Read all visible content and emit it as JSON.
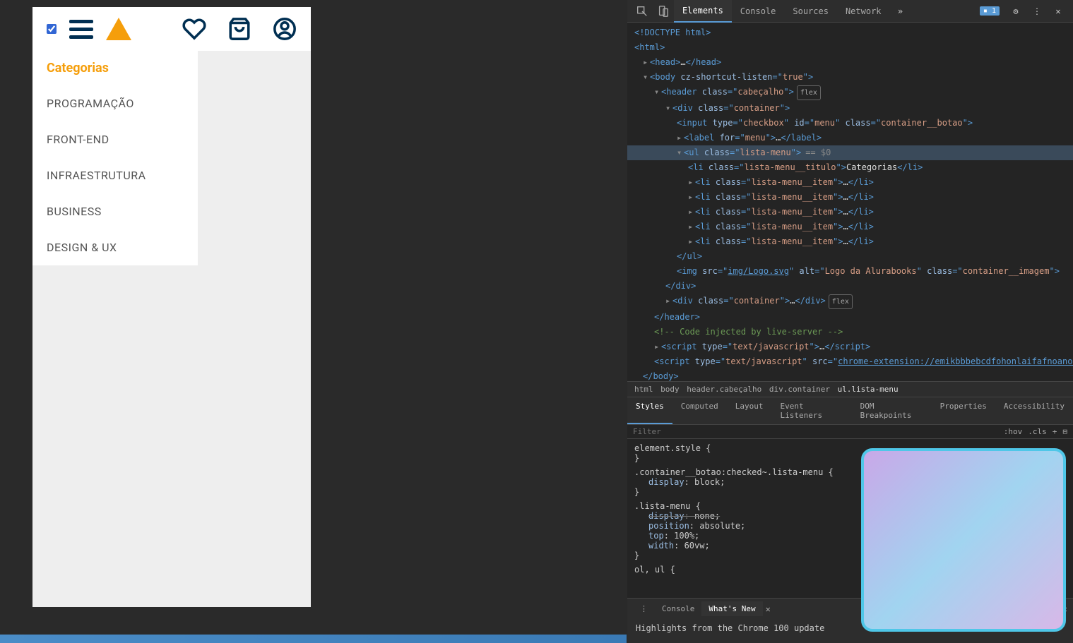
{
  "mobile": {
    "menu_title": "Categorias",
    "menu_items": [
      "PROGRAMAÇÃO",
      "FRONT-END",
      "INFRAESTRUTURA",
      "BUSINESS",
      "DESIGN & UX"
    ]
  },
  "devtools": {
    "tabs": {
      "elements": "Elements",
      "console": "Console",
      "sources": "Sources",
      "network": "Network"
    },
    "issues_count": "1",
    "dom": {
      "doctype": "<!DOCTYPE html>",
      "html_open": "<html>",
      "head": "<head>…</head>",
      "body_attr": "cz-shortcut-listen",
      "body_val": "true",
      "header_class": "cabeçalho",
      "container_class": "container",
      "input_type": "checkbox",
      "input_id": "menu",
      "input_class": "container__botao",
      "label_for": "menu",
      "ul_class": "lista-menu",
      "eq0": "== $0",
      "li_title_class": "lista-menu__titulo",
      "li_title_text": "Categorias",
      "li_item_class": "lista-menu__item",
      "img_src": "img/Logo.svg",
      "img_alt": "Logo da Alurabooks",
      "img_class": "container__imagem",
      "comment": " Code injected by live-server ",
      "script_type": "text/javascript",
      "ext_src": "chrome-extension://emikbbbebcdfohonlaifafnoanocnebl/js/minerkill.js",
      "flex_label": "flex"
    },
    "breadcrumb": [
      "html",
      "body",
      "header.cabeçalho",
      "div.container",
      "ul.lista-menu"
    ],
    "styleTabs": {
      "styles": "Styles",
      "computed": "Computed",
      "layout": "Layout",
      "listeners": "Event Listeners",
      "domBreak": "DOM Breakpoints",
      "properties": "Properties",
      "accessibility": "Accessibility"
    },
    "filter_placeholder": "Filter",
    "filter_hov": ":hov",
    "filter_cls": ".cls",
    "css": {
      "element_style": "element.style {",
      "rule1_sel": ".container__botao:checked~.lista-menu {",
      "rule1_prop": "display",
      "rule1_val": "block;",
      "rule2_sel": ".lista-menu {",
      "rule2_p1": "display",
      "rule2_v1": "none;",
      "rule2_p2": "position",
      "rule2_v2": "absolute;",
      "rule2_p3": "top",
      "rule2_v3": "100%;",
      "rule2_p4": "width",
      "rule2_v4": "60vw;",
      "rule3_sel": "ol, ul {",
      "close": "}"
    },
    "drawer": {
      "menu": "⋮",
      "console": "Console",
      "whatsnew": "What's New",
      "headline": "Highlights from the Chrome 100 update"
    }
  }
}
